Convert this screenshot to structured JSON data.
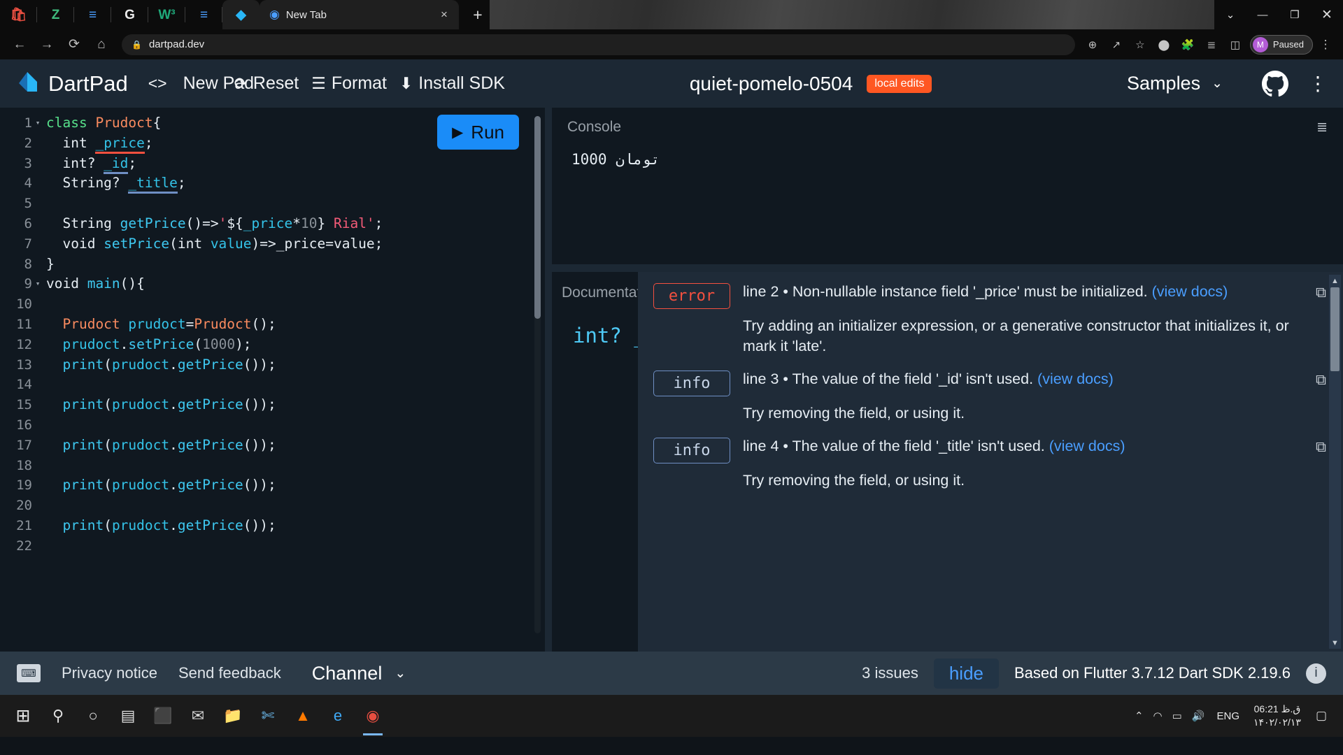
{
  "browser": {
    "pinned_tabs": [
      {
        "name": "shopping-bag-icon",
        "glyph": "🛍",
        "color": "#e84e40"
      },
      {
        "name": "zotero-icon",
        "glyph": "Z",
        "color": "#3fba7d"
      },
      {
        "name": "fastmail-icon",
        "glyph": "≡",
        "color": "#4a9eff"
      },
      {
        "name": "google-icon",
        "glyph": "G",
        "color": "#eaeaea"
      },
      {
        "name": "w3-icon",
        "glyph": "W³",
        "color": "#1fa97a"
      },
      {
        "name": "fastmail-alt-icon",
        "glyph": "≡",
        "color": "#4a9eff"
      },
      {
        "name": "dartpad-icon",
        "glyph": "◆",
        "color": "#29b6f6"
      }
    ],
    "active_tab": {
      "favicon": "chrome-icon",
      "title": "New Tab",
      "close_label": "×"
    },
    "new_tab_label": "+",
    "window_controls": {
      "expand": "⌄",
      "minimize": "—",
      "maximize": "❐",
      "close": "✕"
    },
    "nav": {
      "back": "←",
      "forward": "→",
      "reload": "⟳",
      "home": "⌂"
    },
    "omnibox": {
      "lock": "🔒",
      "url": "dartpad.dev"
    },
    "omnibox_actions": [
      {
        "name": "zoom-icon",
        "glyph": "⊕"
      },
      {
        "name": "share-icon",
        "glyph": "↗"
      },
      {
        "name": "bookmark-star-icon",
        "glyph": "☆"
      },
      {
        "name": "extension-pill-icon",
        "glyph": "⬤"
      },
      {
        "name": "extensions-puzzle-icon",
        "glyph": "🧩"
      },
      {
        "name": "reading-list-icon",
        "glyph": "≣"
      },
      {
        "name": "side-panel-icon",
        "glyph": "◫"
      }
    ],
    "profile": {
      "initial": "M",
      "label": "Paused"
    },
    "menu_dots": "⋮"
  },
  "dartpad": {
    "header": {
      "logo_icon": "dart-logo-icon",
      "logo_text": "DartPad",
      "embed_icon": "<>",
      "new_pad_label": "New Pad",
      "reset_icon": "⟳",
      "reset_label": "Reset",
      "format_icon": "☰",
      "format_label": "Format",
      "install_icon": "⬇",
      "install_label": "Install SDK",
      "pad_name": "quiet-pomelo-0504",
      "local_edits_badge": "local edits",
      "samples_label": "Samples",
      "samples_caret": "⌄",
      "github_icon": "github-icon",
      "more_icon": "⋮"
    },
    "editor": {
      "run_label": "Run",
      "run_play_glyph": "▶",
      "lines": [
        {
          "n": "1",
          "fold": "▾",
          "tokens": [
            {
              "t": "class ",
              "c": "kw2"
            },
            {
              "t": "Prudoct",
              "c": "typ"
            },
            {
              "t": "{",
              "c": "pun"
            }
          ]
        },
        {
          "n": "2",
          "fold": "",
          "tokens": [
            {
              "t": "  int ",
              "c": "plain"
            },
            {
              "t": "_price",
              "c": "var",
              "u": "err"
            },
            {
              "t": ";",
              "c": "pun"
            }
          ]
        },
        {
          "n": "3",
          "fold": "",
          "tokens": [
            {
              "t": "  int? ",
              "c": "plain"
            },
            {
              "t": "_id",
              "c": "var",
              "u": "info"
            },
            {
              "t": ";",
              "c": "pun"
            }
          ]
        },
        {
          "n": "4",
          "fold": "",
          "tokens": [
            {
              "t": "  String? ",
              "c": "plain"
            },
            {
              "t": "_title",
              "c": "var",
              "u": "info"
            },
            {
              "t": ";",
              "c": "pun"
            }
          ]
        },
        {
          "n": "5",
          "fold": "",
          "tokens": []
        },
        {
          "n": "6",
          "fold": "",
          "tokens": [
            {
              "t": "  String ",
              "c": "plain"
            },
            {
              "t": "getPrice",
              "c": "fn"
            },
            {
              "t": "()=>",
              "c": "pun"
            },
            {
              "t": "'",
              "c": "str"
            },
            {
              "t": "${",
              "c": "pun"
            },
            {
              "t": "_price",
              "c": "var"
            },
            {
              "t": "*",
              "c": "pun"
            },
            {
              "t": "10",
              "c": "num"
            },
            {
              "t": "} ",
              "c": "pun"
            },
            {
              "t": "Rial'",
              "c": "str"
            },
            {
              "t": ";",
              "c": "pun"
            }
          ]
        },
        {
          "n": "7",
          "fold": "",
          "tokens": [
            {
              "t": "  void ",
              "c": "plain"
            },
            {
              "t": "setPrice",
              "c": "fn"
            },
            {
              "t": "(int ",
              "c": "plain"
            },
            {
              "t": "value",
              "c": "var"
            },
            {
              "t": ")=>",
              "c": "pun"
            },
            {
              "t": "_price",
              "c": "plain"
            },
            {
              "t": "=",
              "c": "pun"
            },
            {
              "t": "value",
              "c": "plain"
            },
            {
              "t": ";",
              "c": "pun"
            }
          ]
        },
        {
          "n": "8",
          "fold": "",
          "tokens": [
            {
              "t": "}",
              "c": "pun"
            }
          ]
        },
        {
          "n": "9",
          "fold": "▾",
          "tokens": [
            {
              "t": "void ",
              "c": "plain"
            },
            {
              "t": "main",
              "c": "fn"
            },
            {
              "t": "(){",
              "c": "pun"
            }
          ]
        },
        {
          "n": "10",
          "fold": "",
          "tokens": []
        },
        {
          "n": "11",
          "fold": "",
          "tokens": [
            {
              "t": "  Prudoct ",
              "c": "typ"
            },
            {
              "t": "prudoct",
              "c": "var"
            },
            {
              "t": "=",
              "c": "plain"
            },
            {
              "t": "Prudoct",
              "c": "typ"
            },
            {
              "t": "();",
              "c": "pun"
            }
          ]
        },
        {
          "n": "12",
          "fold": "",
          "tokens": [
            {
              "t": "  ",
              "c": "plain"
            },
            {
              "t": "prudoct",
              "c": "var"
            },
            {
              "t": ".",
              "c": "pun"
            },
            {
              "t": "setPrice",
              "c": "fn"
            },
            {
              "t": "(",
              "c": "pun"
            },
            {
              "t": "1000",
              "c": "num"
            },
            {
              "t": ");",
              "c": "pun"
            }
          ]
        },
        {
          "n": "13",
          "fold": "",
          "tokens": [
            {
              "t": "  ",
              "c": "plain"
            },
            {
              "t": "print",
              "c": "fn"
            },
            {
              "t": "(",
              "c": "pun"
            },
            {
              "t": "prudoct",
              "c": "var"
            },
            {
              "t": ".",
              "c": "pun"
            },
            {
              "t": "getPrice",
              "c": "fn"
            },
            {
              "t": "());",
              "c": "pun"
            }
          ]
        },
        {
          "n": "14",
          "fold": "",
          "tokens": []
        },
        {
          "n": "15",
          "fold": "",
          "tokens": [
            {
              "t": "  ",
              "c": "plain"
            },
            {
              "t": "print",
              "c": "fn"
            },
            {
              "t": "(",
              "c": "pun"
            },
            {
              "t": "prudoct",
              "c": "var"
            },
            {
              "t": ".",
              "c": "pun"
            },
            {
              "t": "getPrice",
              "c": "fn"
            },
            {
              "t": "());",
              "c": "pun"
            }
          ]
        },
        {
          "n": "16",
          "fold": "",
          "tokens": []
        },
        {
          "n": "17",
          "fold": "",
          "tokens": [
            {
              "t": "  ",
              "c": "plain"
            },
            {
              "t": "print",
              "c": "fn"
            },
            {
              "t": "(",
              "c": "pun"
            },
            {
              "t": "prudoct",
              "c": "var"
            },
            {
              "t": ".",
              "c": "pun"
            },
            {
              "t": "getPrice",
              "c": "fn"
            },
            {
              "t": "());",
              "c": "pun"
            }
          ]
        },
        {
          "n": "18",
          "fold": "",
          "tokens": []
        },
        {
          "n": "19",
          "fold": "",
          "tokens": [
            {
              "t": "  ",
              "c": "plain"
            },
            {
              "t": "print",
              "c": "fn"
            },
            {
              "t": "(",
              "c": "pun"
            },
            {
              "t": "prudoct",
              "c": "var"
            },
            {
              "t": ".",
              "c": "pun"
            },
            {
              "t": "getPrice",
              "c": "fn"
            },
            {
              "t": "());",
              "c": "pun"
            }
          ]
        },
        {
          "n": "20",
          "fold": "",
          "tokens": []
        },
        {
          "n": "21",
          "fold": "",
          "tokens": [
            {
              "t": "  ",
              "c": "plain"
            },
            {
              "t": "print",
              "c": "fn"
            },
            {
              "t": "(",
              "c": "pun"
            },
            {
              "t": "prudoct",
              "c": "var"
            },
            {
              "t": ".",
              "c": "pun"
            },
            {
              "t": "getPrice",
              "c": "fn"
            },
            {
              "t": "());",
              "c": "pun"
            }
          ]
        },
        {
          "n": "22",
          "fold": "",
          "tokens": []
        }
      ]
    },
    "console": {
      "title": "Console",
      "clear_icon": "≣",
      "output": "1000 تومان"
    },
    "documentation": {
      "title": "Documentation",
      "snippet": "int? _"
    },
    "issues": [
      {
        "severity": "error",
        "message": "line 2 • Non-nullable instance field '_price' must be initialized.",
        "view_docs": "(view docs)",
        "fix": "Try adding an initializer expression, or a generative constructor that initializes it, or mark it 'late'.",
        "copy_icon": "⧉"
      },
      {
        "severity": "info",
        "message": "line 3 • The value of the field '_id' isn't used.",
        "view_docs": "(view docs)",
        "fix": "Try removing the field, or using it.",
        "copy_icon": "⧉"
      },
      {
        "severity": "info",
        "message": "line 4 • The value of the field '_title' isn't used.",
        "view_docs": "(view docs)",
        "fix": "Try removing the field, or using it.",
        "copy_icon": "⧉"
      }
    ],
    "scroll_arrows": {
      "up": "▲",
      "down": "▼"
    },
    "footer": {
      "keyboard_icon": "⌨",
      "privacy_label": "Privacy notice",
      "feedback_label": "Send feedback",
      "channel_label": "Channel",
      "channel_caret": "⌄",
      "issues_count": "3 issues",
      "hide_label": "hide",
      "sdk_info": "Based on Flutter 3.7.12 Dart SDK 2.19.6",
      "info_icon": "i"
    }
  },
  "taskbar": {
    "start_icon": "⊞",
    "items": [
      {
        "name": "search-icon",
        "glyph": "⚲",
        "color": "#e0e0e0"
      },
      {
        "name": "cortana-icon",
        "glyph": "○",
        "color": "#e0e0e0"
      },
      {
        "name": "task-view-icon",
        "glyph": "▤",
        "color": "#e0e0e0"
      },
      {
        "name": "microsoft-store-icon",
        "glyph": "⬛",
        "color": "#4a9eff"
      },
      {
        "name": "mail-icon",
        "glyph": "✉",
        "color": "#d8d8d8"
      },
      {
        "name": "file-explorer-icon",
        "glyph": "📁",
        "color": "#f0c040"
      },
      {
        "name": "snipping-tool-icon",
        "glyph": "✄",
        "color": "#6fc0f5"
      },
      {
        "name": "vlc-icon",
        "glyph": "▲",
        "color": "#ff7a00"
      },
      {
        "name": "edge-icon",
        "glyph": "e",
        "color": "#3fa9f5"
      },
      {
        "name": "chrome-icon",
        "glyph": "◉",
        "color": "#e84e40"
      }
    ],
    "tray": [
      {
        "name": "show-hidden-icons",
        "glyph": "⌃"
      },
      {
        "name": "network-icon",
        "glyph": "◠"
      },
      {
        "name": "battery-icon",
        "glyph": "▭"
      },
      {
        "name": "volume-icon",
        "glyph": "🔊"
      }
    ],
    "language": "ENG",
    "clock_time": "ق.ظ 06:21",
    "clock_date": "۱۴۰۲/۰۲/۱۳",
    "notification_icon": "▢"
  }
}
